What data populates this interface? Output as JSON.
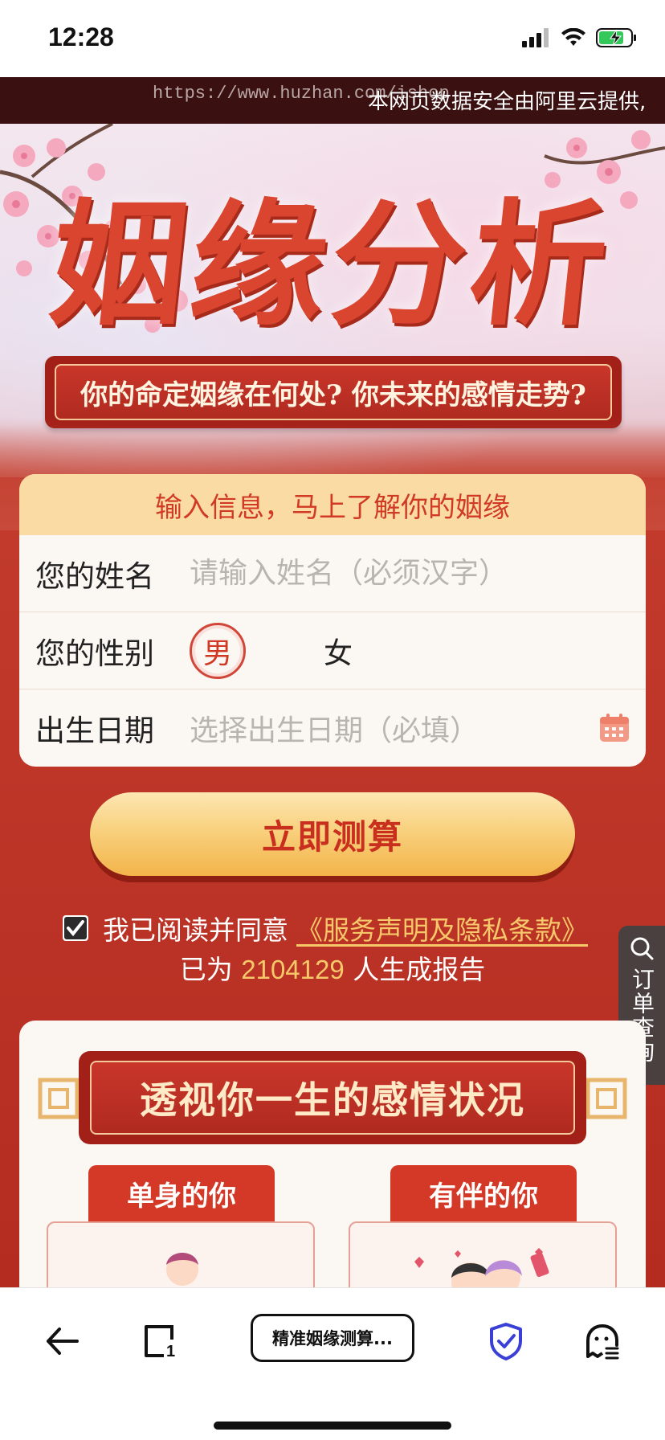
{
  "status_bar": {
    "time": "12:28",
    "icons": [
      "signal-icon",
      "wifi-icon",
      "battery-charging-icon"
    ]
  },
  "url_banner": {
    "url": "https://www.huzhan.com/ishop",
    "notice": "本网页数据安全由阿里云提供,"
  },
  "hero": {
    "title": "姻缘分析",
    "subtitle": "你的命定姻缘在何处? 你未来的感情走势?"
  },
  "form": {
    "header": "输入信息，马上了解你的姻缘",
    "name_label": "您的姓名",
    "name_placeholder": "请输入姓名（必须汉字）",
    "name_value": "",
    "gender_label": "您的性别",
    "gender_options": [
      "男",
      "女"
    ],
    "gender_selected": "男",
    "birth_label": "出生日期",
    "birth_placeholder": "选择出生日期（必填）"
  },
  "submit_label": "立即测算",
  "agreement": {
    "checked": true,
    "text": "我已阅读并同意",
    "link": "《服务声明及隐私条款》"
  },
  "report_count": {
    "prefix": "已为",
    "count": "2104129",
    "suffix": "人生成报告"
  },
  "order_tab": {
    "label": "订单查询"
  },
  "section": {
    "title": "透视你一生的感情状况",
    "tabs": [
      "单身的你",
      "有伴的你"
    ]
  },
  "toolbar": {
    "title": "精准姻缘测算..."
  },
  "colors": {
    "primary_red": "#b42c20",
    "gold": "#f6c86a",
    "cream": "#fbf7f2",
    "peach": "#fbdba4"
  }
}
